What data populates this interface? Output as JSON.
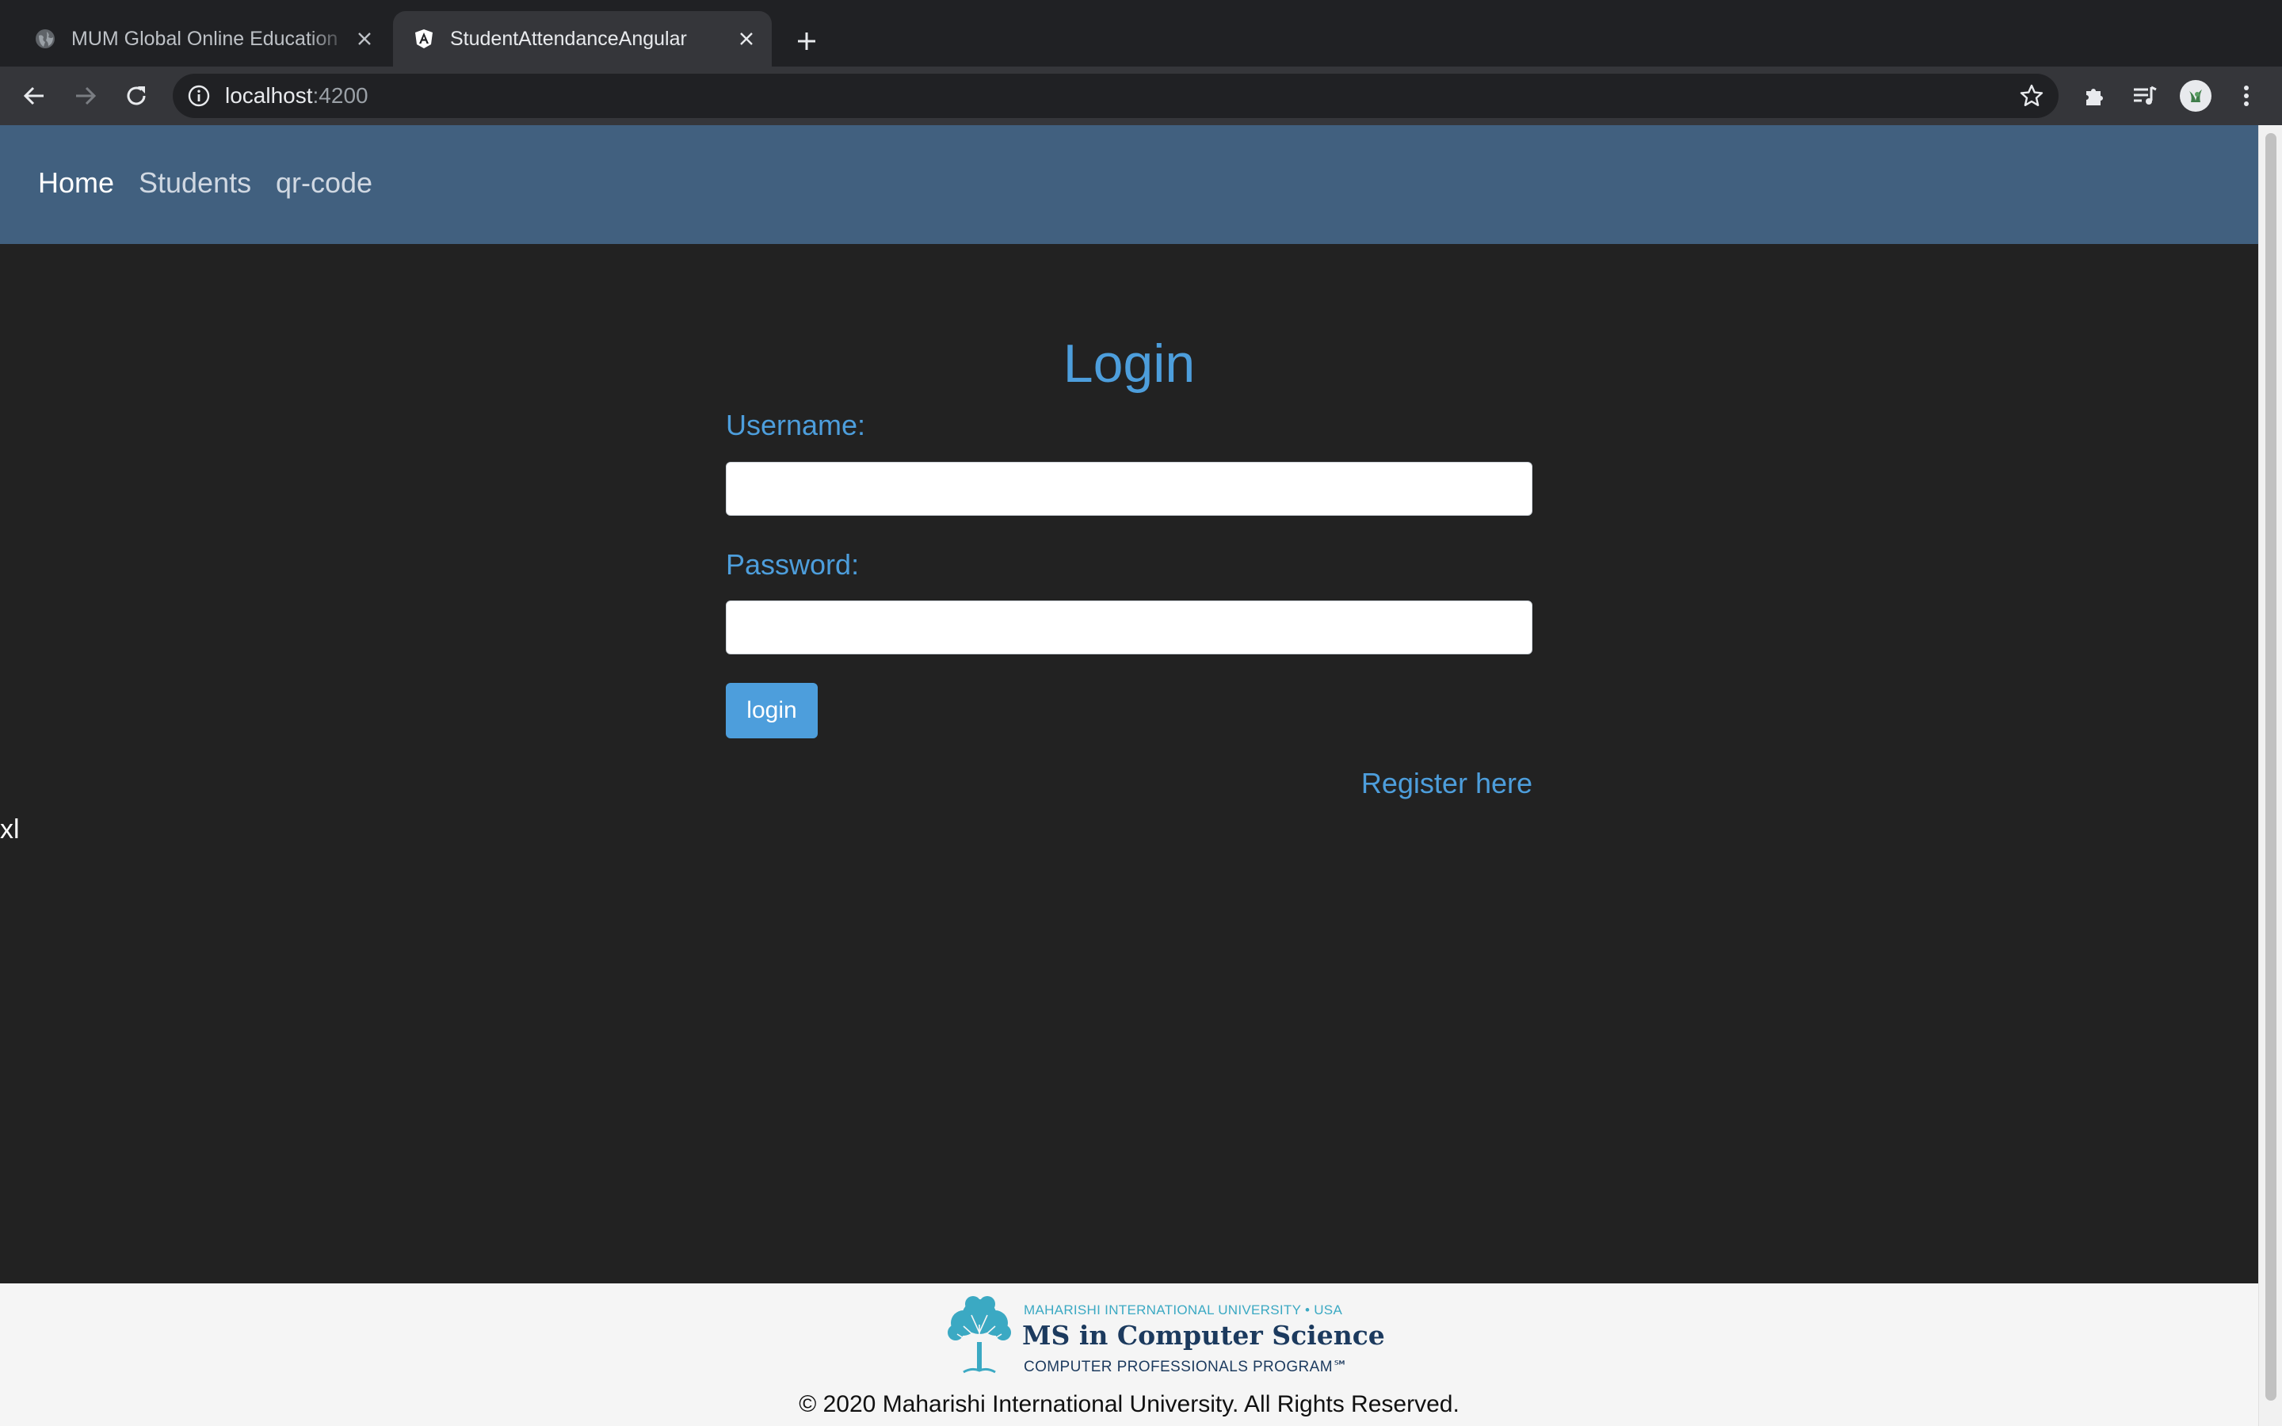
{
  "browser": {
    "tabs": [
      {
        "title": "MUM Global Online Education",
        "active": false
      },
      {
        "title": "StudentAttendanceAngular",
        "active": true
      }
    ],
    "url_host": "localhost",
    "url_port": ":4200"
  },
  "nav": {
    "items": [
      {
        "label": "Home",
        "active": true
      },
      {
        "label": "Students",
        "active": false
      },
      {
        "label": "qr-code",
        "active": false
      }
    ]
  },
  "login": {
    "title": "Login",
    "username_label": "Username:",
    "username_value": "",
    "password_label": "Password:",
    "password_value": "",
    "button_label": "login",
    "register_link": "Register here"
  },
  "stray_text": "xl",
  "footer": {
    "logo_top": "MAHARISHI INTERNATIONAL UNIVERSITY • USA",
    "logo_main": "MS in Computer Science",
    "logo_sub": "COMPUTER PROFESSIONALS PROGRAM℠",
    "copyright": "© 2020 Maharishi International University. All Rights Reserved."
  },
  "colors": {
    "accent": "#4d9edc",
    "navbar": "#41607f",
    "page_bg": "#222222",
    "footer_bg": "#f5f5f5"
  },
  "icons": [
    "globe-icon",
    "angular-icon",
    "close-icon",
    "plus-icon",
    "back-arrow-icon",
    "forward-arrow-icon",
    "reload-icon",
    "info-icon",
    "star-icon",
    "puzzle-icon",
    "media-queue-icon",
    "avatar",
    "kebab-menu-icon"
  ]
}
